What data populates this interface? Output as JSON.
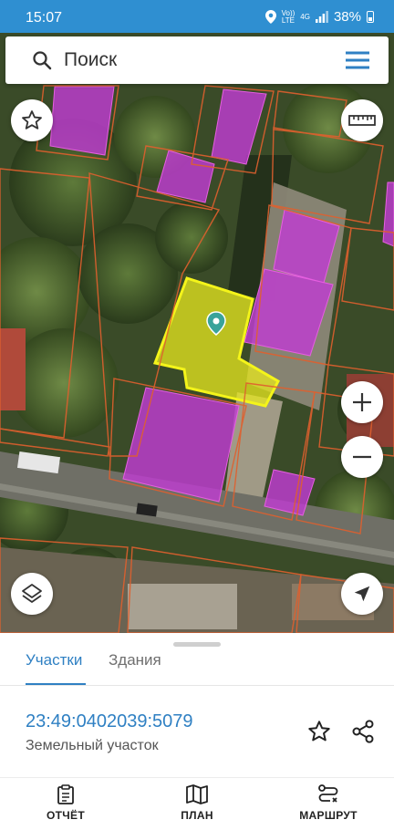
{
  "status_bar": {
    "time": "15:07",
    "network_top": "Vo))",
    "network_bottom": "LTE",
    "signal_type": "4G",
    "battery": "38%"
  },
  "search": {
    "placeholder": "Поиск",
    "value": ""
  },
  "tabs": [
    {
      "label": "Участки",
      "active": true
    },
    {
      "label": "Здания",
      "active": false
    }
  ],
  "parcel": {
    "cadastral_number": "23:49:0402039:5079",
    "type": "Земельный участок"
  },
  "bottom_nav": [
    {
      "label": "ОТЧЁТ",
      "icon": "clipboard-icon"
    },
    {
      "label": "ПЛАН",
      "icon": "map-icon"
    },
    {
      "label": "МАРШРУТ",
      "icon": "route-icon"
    }
  ],
  "colors": {
    "accent": "#2f80c3",
    "status_bar": "#2f8fd1",
    "selected_parcel": "#e8e81e",
    "building_overlay": "#c03cd2",
    "parcel_border": "#e0602e",
    "marker": "#3aa39a"
  },
  "icons": {
    "search": "search-icon",
    "menu": "menu-icon",
    "favorite": "star-icon",
    "ruler": "ruler-icon",
    "zoom_in": "plus-icon",
    "zoom_out": "minus-icon",
    "layers": "layers-icon",
    "locate": "navigation-arrow-icon",
    "share": "share-icon"
  }
}
